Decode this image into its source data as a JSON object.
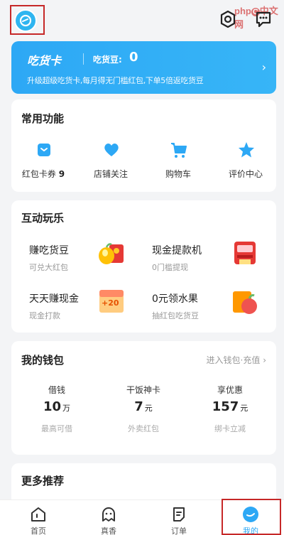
{
  "watermark": {
    "text": "php",
    "badge": "C",
    "cn": "中文网"
  },
  "header": {
    "avatar_icon": "app-logo-icon",
    "settings_icon": "settings-icon",
    "message_icon": "message-icon"
  },
  "chihuo_card": {
    "title": "吃货卡",
    "beans_label": "吃货豆:",
    "beans_value": "0",
    "subtitle": "升级超级吃货卡,每月得无门槛红包,下单5倍返吃货豆",
    "chevron": "›"
  },
  "common": {
    "title": "常用功能",
    "items": [
      {
        "label": "红包卡券",
        "count": "9",
        "icon": "wallet-icon"
      },
      {
        "label": "店铺关注",
        "icon": "heart-icon"
      },
      {
        "label": "购物车",
        "icon": "cart-icon"
      },
      {
        "label": "评价中心",
        "icon": "star-icon"
      }
    ]
  },
  "play": {
    "title": "互动玩乐",
    "items": [
      {
        "title": "赚吃货豆",
        "sub": "可兑大红包",
        "icon": "bean-redpacket-icon"
      },
      {
        "title": "现金提款机",
        "sub": "0门槛提现",
        "icon": "atm-icon"
      },
      {
        "title": "天天赚现金",
        "sub": "现金打款",
        "icon": "cash-plus20-icon",
        "badge": "+20"
      },
      {
        "title": "0元领水果",
        "sub": "抽红包吃货豆",
        "icon": "fruit-gift-icon"
      }
    ]
  },
  "wallet": {
    "title": "我的钱包",
    "link": "进入钱包·充值",
    "link_chevron": "›",
    "cols": [
      {
        "label": "借钱",
        "value": "10",
        "unit": "万",
        "sub": "最高可借"
      },
      {
        "label": "干饭神卡",
        "value": "7",
        "unit": "元",
        "sub": "外卖红包"
      },
      {
        "label": "享优惠",
        "value": "157",
        "unit": "元",
        "sub": "绑卡立减"
      }
    ]
  },
  "more": {
    "title": "更多推荐"
  },
  "nav": {
    "items": [
      {
        "label": "首页",
        "icon": "home-icon"
      },
      {
        "label": "真香",
        "icon": "ghost-icon"
      },
      {
        "label": "订单",
        "icon": "order-icon"
      },
      {
        "label": "我的",
        "icon": "profile-icon"
      }
    ]
  },
  "colors": {
    "accent": "#2da8f5",
    "highlight_box": "#c62828"
  }
}
